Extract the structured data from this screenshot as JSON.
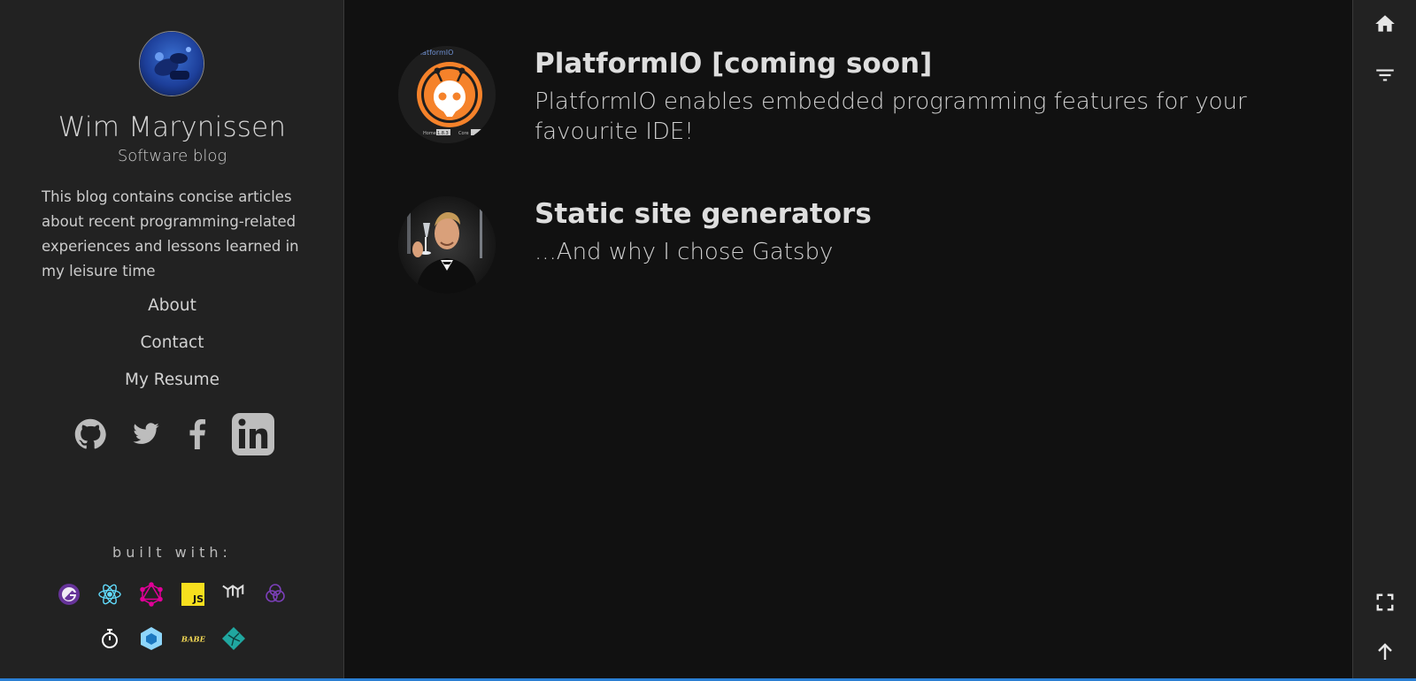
{
  "sidebar": {
    "author_name": "Wim Marynissen",
    "subtitle": "Software blog",
    "bio": "This blog contains concise articles about recent programming-related experiences and lessons learned in my leisure time",
    "nav": {
      "about": "About",
      "contact": "Contact",
      "resume": "My Resume"
    },
    "social_icons": [
      "github-icon",
      "twitter-icon",
      "facebook-icon",
      "linkedin-icon"
    ],
    "built_with_label": "built with:",
    "tech_icons": [
      "gatsby-icon",
      "react-icon",
      "graphql-icon",
      "javascript-icon",
      "material-ui-icon",
      "styled-icon",
      "jest-icon",
      "webpack-icon",
      "babel-icon",
      "netlify-icon"
    ]
  },
  "posts": [
    {
      "title": "PlatformIO [coming soon]",
      "description": "PlatformIO enables embedded programming features for your favourite IDE!",
      "thumb_text": "PlatformIO",
      "thumb_home": "Home",
      "thumb_version": "1.8.3",
      "thumb_core": "Core"
    },
    {
      "title": "Static site generators",
      "description": "...And why I chose Gatsby"
    }
  ],
  "rail": {
    "icons": [
      "home-icon",
      "filter-icon",
      "fullscreen-icon",
      "arrow-up-icon"
    ]
  },
  "colors": {
    "background": "#111111",
    "sidebar": "#222222",
    "text": "#dddddd",
    "platformio_orange": "#f5822a",
    "accent_blue": "#2a7fd4"
  }
}
